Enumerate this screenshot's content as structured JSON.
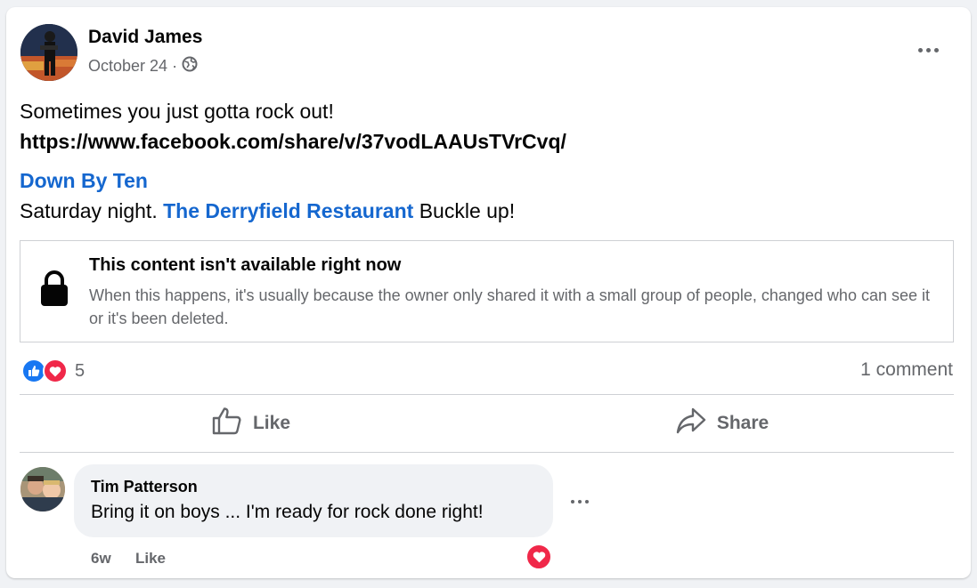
{
  "post": {
    "author": "David James",
    "date": "October 24",
    "date_separator": "·",
    "privacy_icon": "globe-icon",
    "text_line1": "Sometimes you just gotta rock out!",
    "url": "https://www.facebook.com/share/v/37vodLAAUsTVrCvq/",
    "band_link": "Down By Ten",
    "line3_prefix": "Saturday night. ",
    "venue_link": "The Derryfield Restaurant",
    "line3_suffix": " Buckle up!",
    "more_icon": "more-options-icon"
  },
  "unavailable": {
    "icon": "lock-icon",
    "title": "This content isn't available right now",
    "body": "When this happens, it's usually because the owner only shared it with a small group of people, changed who can see it or it's been deleted."
  },
  "reactions": {
    "icons": [
      "like-reaction-icon",
      "love-reaction-icon"
    ],
    "count": "5",
    "comment_count": "1 comment"
  },
  "actions": {
    "like_label": "Like",
    "share_label": "Share"
  },
  "comment": {
    "author": "Tim Patterson",
    "text": "Bring it on boys ... I'm ready for rock done right!",
    "time": "6w",
    "like_label": "Like",
    "reaction_icon": "love-reaction-icon"
  },
  "colors": {
    "link": "#1567cf",
    "like_blue": "#1877f2",
    "love_red": "#f02849",
    "secondary_text": "#65676b",
    "background": "#f0f2f5"
  }
}
